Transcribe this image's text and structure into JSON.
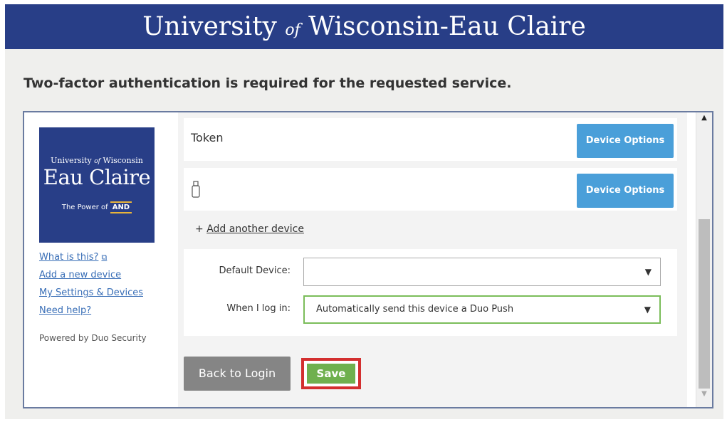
{
  "banner": {
    "pre": "University",
    "of": "of",
    "post": "Wisconsin-Eau Claire"
  },
  "headline": "Two-factor authentication is required for the requested service.",
  "logo": {
    "line1_pre": "University",
    "line1_of": "of",
    "line1_post": "Wisconsin",
    "line2": "Eau Claire",
    "tagline": "The Power of",
    "and": "AND"
  },
  "sidebar": {
    "links": [
      {
        "label": "What is this?",
        "icon": "external-link-icon"
      },
      {
        "label": "Add a new device"
      },
      {
        "label": "My Settings & Devices"
      },
      {
        "label": "Need help?"
      }
    ],
    "powered_by": "Powered by Duo Security"
  },
  "devices": [
    {
      "name": "Token",
      "button": "Device Options"
    },
    {
      "name": "",
      "icon": "usb-key-icon",
      "button": "Device Options"
    }
  ],
  "add_device": {
    "prefix": "+",
    "label": "Add another device"
  },
  "settings": {
    "default_device_label": "Default Device:",
    "default_device_value": "",
    "when_login_label": "When I log in:",
    "when_login_value": "Automatically send this device a Duo Push"
  },
  "actions": {
    "back": "Back to Login",
    "save": "Save"
  },
  "colors": {
    "banner": "#283e87",
    "device_button": "#4a9fd9",
    "save_button": "#6fb04e",
    "save_highlight": "#d32f2f",
    "back_button": "#858585"
  }
}
